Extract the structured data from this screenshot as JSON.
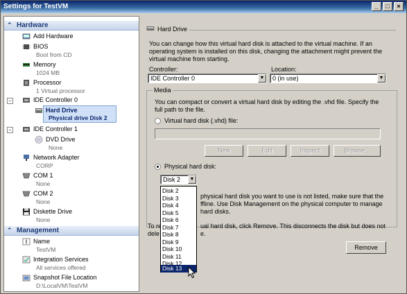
{
  "window": {
    "title": "Settings for TestVM"
  },
  "titlebar_buttons": [
    "_",
    "□",
    "×"
  ],
  "sidebar": {
    "hardware_header": "Hardware",
    "management_header": "Management",
    "items": {
      "add_hardware": {
        "label": "Add Hardware"
      },
      "bios": {
        "label": "BIOS",
        "sub": "Boot from CD"
      },
      "memory": {
        "label": "Memory",
        "sub": "1024 MB"
      },
      "processor": {
        "label": "Processor",
        "sub": "1 Virtual processor"
      },
      "ide0": {
        "label": "IDE Controller 0"
      },
      "hard_drive": {
        "label": "Hard Drive",
        "sub": "Physical  drive Disk 2"
      },
      "ide1": {
        "label": "IDE Controller 1"
      },
      "dvd": {
        "label": "DVD Drive",
        "sub": "None"
      },
      "network": {
        "label": "Network Adapter",
        "sub": "CORP"
      },
      "com1": {
        "label": "COM 1",
        "sub": "None"
      },
      "com2": {
        "label": "COM 2",
        "sub": "None"
      },
      "diskette": {
        "label": "Diskette Drive",
        "sub": "None"
      },
      "name": {
        "label": "Name",
        "sub": "TestVM"
      },
      "integration": {
        "label": "Integration Services",
        "sub": "All services offered"
      },
      "snapshot": {
        "label": "Snapshot File Location",
        "sub": "D:\\LocalVM\\TestVM"
      }
    }
  },
  "main": {
    "header": "Hard Drive",
    "description_lines": [
      "You can change how this virtual hard disk is attached to the virtual machine. If an",
      "operating system is installed on this disk, changing the attachment might prevent the",
      "virtual machine from starting."
    ],
    "controller_label": "Controller:",
    "controller_value": "IDE Controller 0",
    "location_label": "Location:",
    "location_value": "0 (in use)",
    "media": {
      "label": "Media",
      "desc_lines": [
        "You can compact or convert a virtual hard disk by editing the .vhd file. Specify the",
        "full path to the file."
      ],
      "vhd_radio_label": "Virtual hard disk (.vhd) file:",
      "buttons": {
        "new": "New",
        "edit": "Edit",
        "inspect": "Inspect",
        "browse": "Browse..."
      },
      "physical_radio_label": "Physical hard disk:",
      "physical_value": "Disk 2",
      "physical_note_lines": [
        "physical hard disk you want to use is not listed, make sure that the",
        "ffline. Use Disk Management on the physical computer to manage",
        "hard disks."
      ]
    },
    "remove_text_lines": [
      "To re",
      "ual hard disk, click Remove. This disconnects the disk but does not",
      "dele",
      "e."
    ],
    "remove_button": "Remove",
    "dropdown_options": [
      "Disk 2",
      "Disk 3",
      "Disk 4",
      "Disk 5",
      "Disk 6",
      "Disk 7",
      "Disk 8",
      "Disk 9",
      "Disk 10",
      "Disk 11",
      "Disk 12",
      "Disk 13"
    ],
    "dropdown_highlighted": "Disk 13"
  }
}
